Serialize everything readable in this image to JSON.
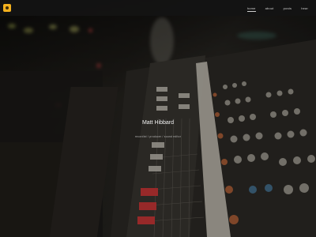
{
  "header": {
    "logo_name": "logo-icon",
    "nav": [
      {
        "label": "home",
        "active": true
      },
      {
        "label": "about",
        "active": false
      },
      {
        "label": "posts",
        "active": false
      },
      {
        "label": "hear",
        "active": false
      }
    ]
  },
  "hero": {
    "title": "Matt Hibbard",
    "subtitle": "recordist / producer / sound editor"
  },
  "colors": {
    "logo": "#f2b01e",
    "topbar": "#141414",
    "title": "#f0f0f0"
  }
}
